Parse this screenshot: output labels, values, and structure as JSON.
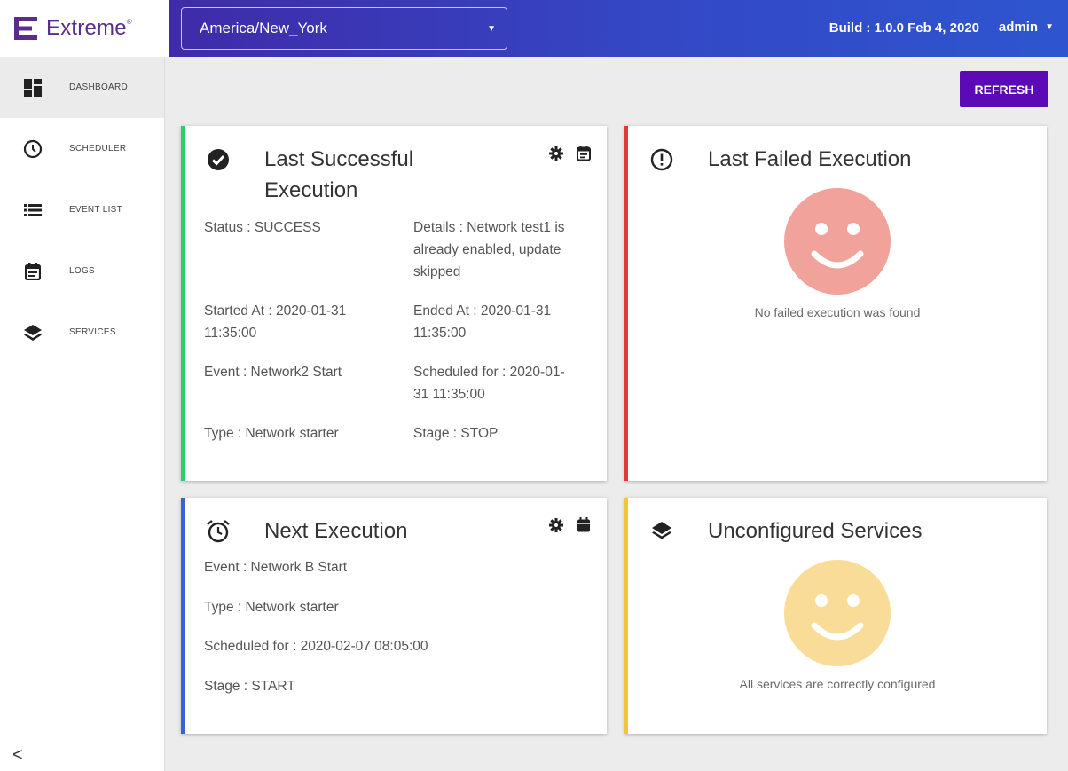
{
  "brand": {
    "name": "Extreme",
    "mark": "®"
  },
  "header": {
    "timezone": "America/New_York",
    "build": "Build : 1.0.0 Feb 4, 2020",
    "user": "admin"
  },
  "sidebar": {
    "items": [
      {
        "label": "DASHBOARD",
        "icon": "dashboard-icon"
      },
      {
        "label": "SCHEDULER",
        "icon": "clock-icon"
      },
      {
        "label": "EVENT LIST",
        "icon": "list-icon"
      },
      {
        "label": "LOGS",
        "icon": "calendar-icon"
      },
      {
        "label": "SERVICES",
        "icon": "layers-icon"
      }
    ],
    "collapse": "<"
  },
  "toolbar": {
    "refresh_label": "REFRESH"
  },
  "last_success": {
    "title_line1": "Last Successful",
    "title_line2": "Execution",
    "status": "Status : SUCCESS",
    "details_line1": "Details : Network test1 is",
    "details_line2": "already enabled, update",
    "details_line3": "skipped",
    "started_line1": "Started At : 2020-01-31",
    "started_line2": "11:35:00",
    "ended_line1": "Ended At : 2020-01-31",
    "ended_line2": "11:35:00",
    "event": "Event : Network2 Start",
    "scheduled_line1": "Scheduled for : 2020-01-",
    "scheduled_line2": "31 11:35:00",
    "type": "Type : Network starter",
    "stage": "Stage : STOP"
  },
  "last_failed": {
    "title": "Last Failed Execution",
    "message": "No failed execution was found"
  },
  "next_execution": {
    "title": "Next Execution",
    "event": "Event : Network B Start",
    "type": "Type : Network starter",
    "scheduled": "Scheduled for : 2020-02-07 08:05:00",
    "stage": "Stage : START"
  },
  "unconfigured": {
    "title": "Unconfigured Services",
    "message": "All services are correctly configured"
  },
  "colors": {
    "brand_purple": "#5a2d8c",
    "header_blue": "#3448c6",
    "refresh_purple": "#5c0ab5",
    "success_green": "#2ecc71",
    "failed_red": "#e53935",
    "next_blue": "#3f5fd6",
    "services_yellow": "#f2c43c",
    "failed_smiley": "#f0a29b",
    "services_smiley": "#f9dc97"
  }
}
